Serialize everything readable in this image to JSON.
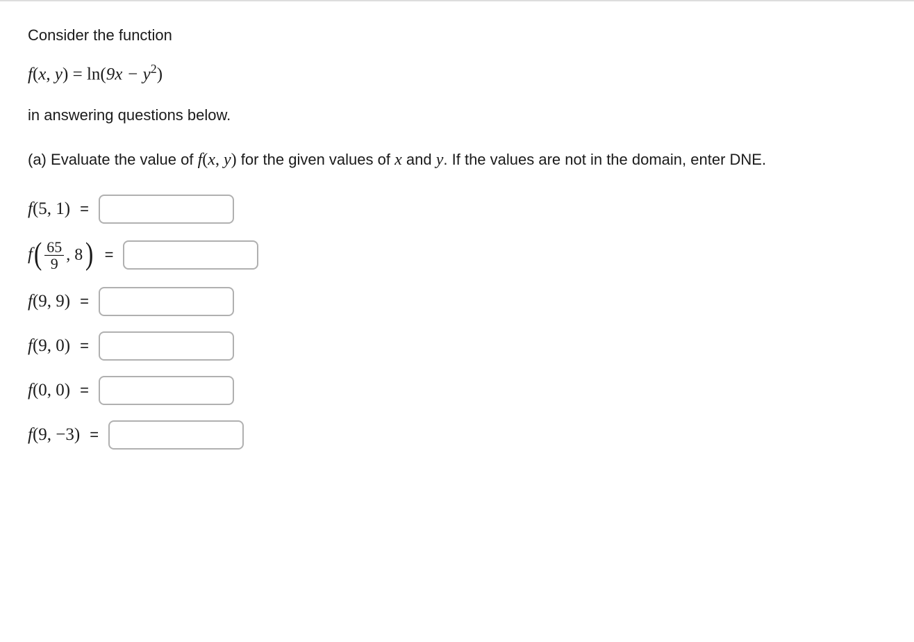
{
  "intro": "Consider the function",
  "function_def": {
    "lhs": "f(x, y)",
    "rhs_prefix": "ln",
    "rhs_arg": "9x − y",
    "rhs_exp": "2"
  },
  "intro_tail": "in answering questions below.",
  "part_a": {
    "label": "(a)",
    "text_before_fxy": "Evaluate the value of",
    "fxy": "f(x, y)",
    "text_mid": "for the given values of",
    "var_x": "x",
    "and_word": "and",
    "var_y": "y",
    "text_tail": ". If the values are not in the domain, enter DNE."
  },
  "questions": [
    {
      "label_html": "f(5, 1)",
      "type": "plain"
    },
    {
      "type": "frac",
      "f": "f",
      "num": "65",
      "den": "9",
      "second": ", 8"
    },
    {
      "label_html": "f(9, 9)",
      "type": "plain"
    },
    {
      "label_html": "f(9, 0)",
      "type": "plain"
    },
    {
      "label_html": "f(0, 0)",
      "type": "plain"
    },
    {
      "label_html": "f(9, −3)",
      "type": "plain"
    }
  ],
  "equals": "="
}
